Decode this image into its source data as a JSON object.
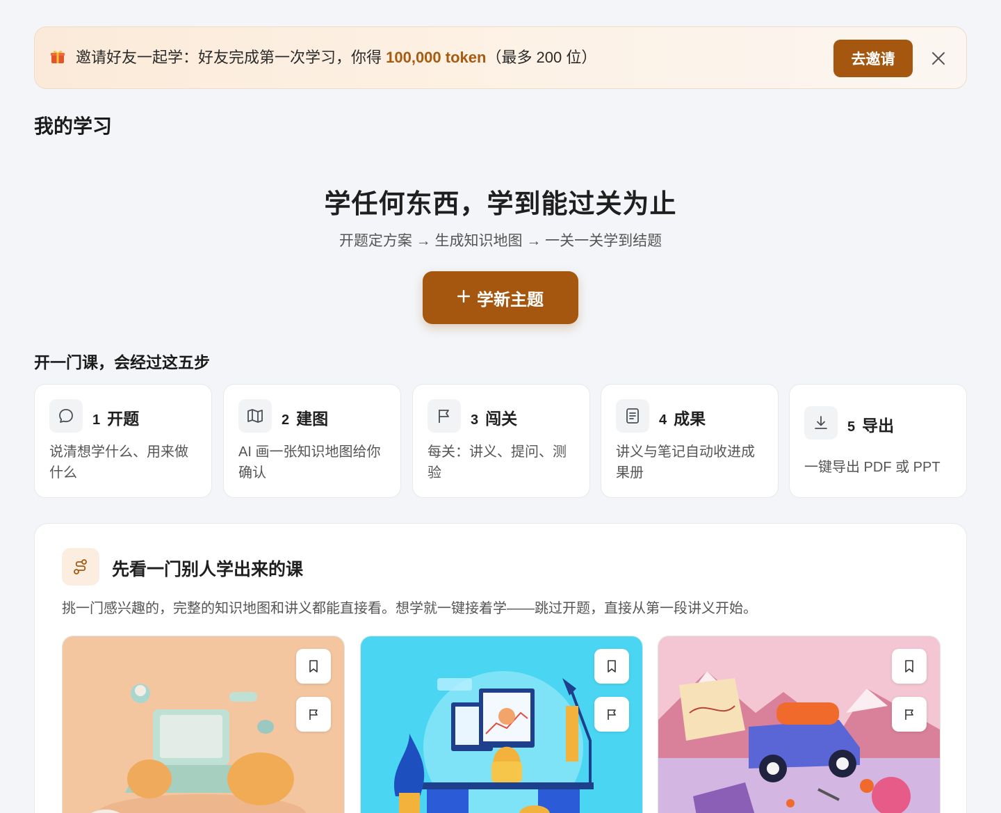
{
  "banner": {
    "icon": "gift-icon",
    "text_prefix": "邀请好友一起学：好友完成第一次学习，你得 ",
    "text_highlight": "100,000 token",
    "text_suffix": "（最多 200 位）",
    "invite_label": "去邀请",
    "accent": "#a5570f"
  },
  "section_title": "我的学习",
  "hero": {
    "title": "学任何东西，学到能过关为止",
    "subtitle": "开题定方案 → 生成知识地图 → 一关一关学到结题",
    "cta_label": "学新主题",
    "cta_icon": "plus-icon"
  },
  "steps": {
    "heading": "开一门课，会经过这五步",
    "items": [
      {
        "num": "1",
        "name": "开题",
        "desc": "说清想学什么、用来做什么",
        "icon": "chat-bubble-icon"
      },
      {
        "num": "2",
        "name": "建图",
        "desc": "AI 画一张知识地图给你确认",
        "icon": "map-icon"
      },
      {
        "num": "3",
        "name": "闯关",
        "desc": "每关：讲义、提问、测验",
        "icon": "flag-icon"
      },
      {
        "num": "4",
        "name": "成果",
        "desc": "讲义与笔记自动收进成果册",
        "icon": "document-icon"
      },
      {
        "num": "5",
        "name": "导出",
        "desc": "一键导出 PDF 或 PPT",
        "icon": "download-icon"
      }
    ]
  },
  "showcase": {
    "icon": "route-icon",
    "title": "先看一门别人学出来的课",
    "desc": "挑一门感兴趣的，完整的知识地图和讲义都能直接看。想学就一键接着学——跳过开题，直接从第一段讲义开始。",
    "cards": [
      {
        "theme": "peach",
        "bg": "#f3c6a0"
      },
      {
        "theme": "cyan",
        "bg": "#4ad6f3"
      },
      {
        "theme": "pink",
        "bg": "#f4c6d3"
      }
    ]
  }
}
